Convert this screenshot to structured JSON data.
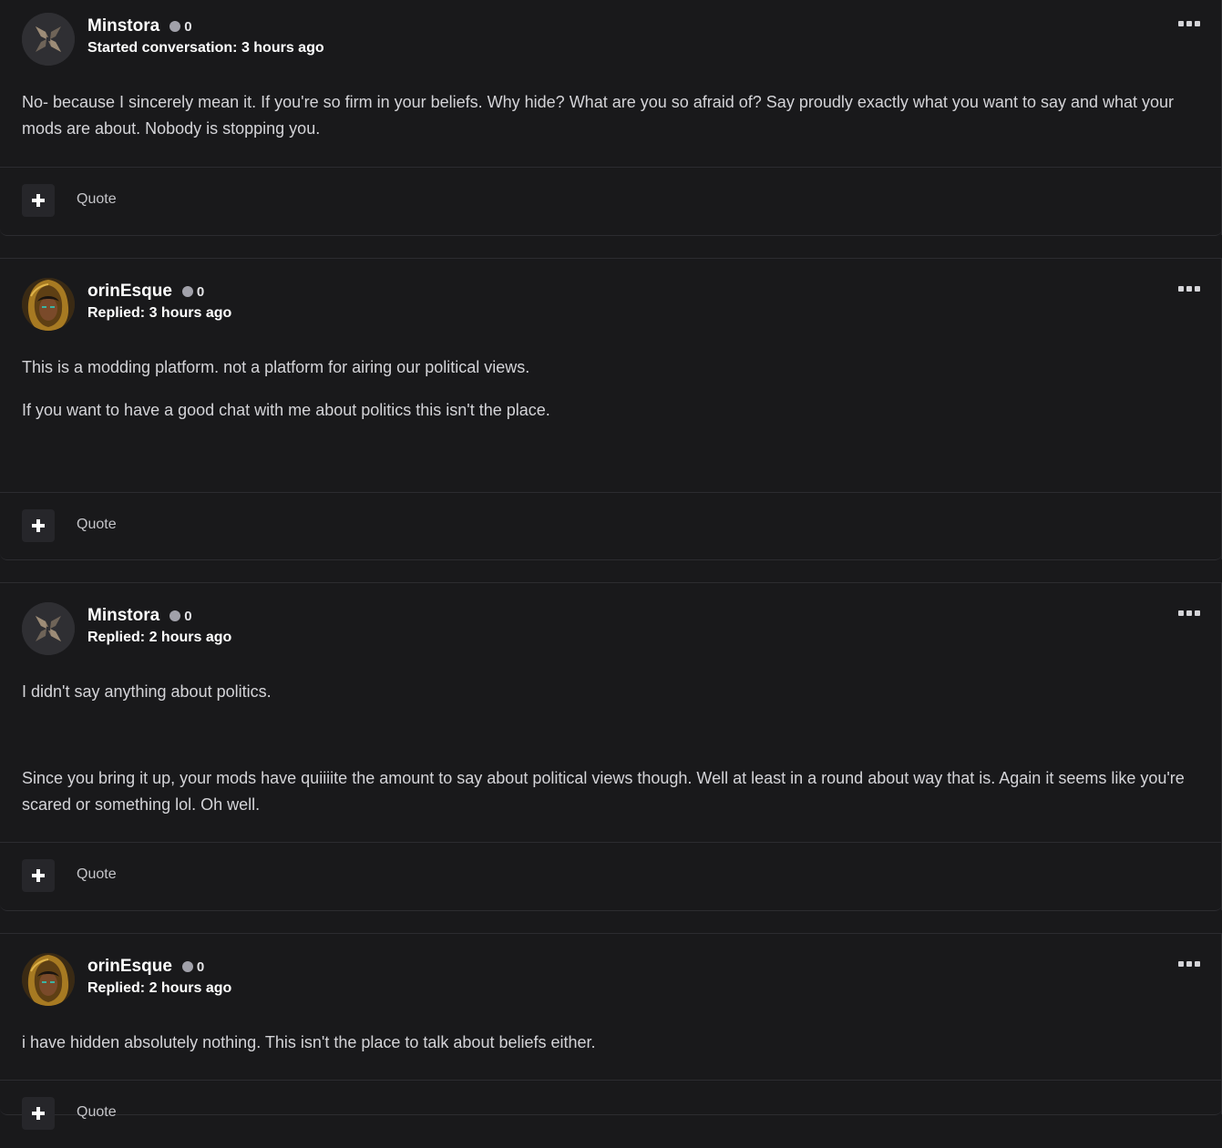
{
  "posts": [
    {
      "username": "Minstora",
      "reputation": "0",
      "action": "Started conversation:",
      "time": "3 hours ago",
      "avatar_icon": "default-avatar-icon",
      "paragraphs": [
        "No- because I sincerely mean it. If you're so firm in your beliefs. Why hide? What are you so afraid of? Say proudly exactly what you want to say and what your mods are about. Nobody is stopping you."
      ],
      "quote_label": "Quote"
    },
    {
      "username": "orinEsque",
      "reputation": "0",
      "action": "Replied:",
      "time": "3 hours ago",
      "avatar_icon": "hooded-character-avatar-icon",
      "paragraphs": [
        "This is a modding platform. not a platform for airing our political views.",
        "If you want to have a good chat with me about politics this isn't the place."
      ],
      "quote_label": "Quote"
    },
    {
      "username": "Minstora",
      "reputation": "0",
      "action": "Replied:",
      "time": "2 hours ago",
      "avatar_icon": "default-avatar-icon",
      "paragraphs": [
        "I didn't say anything about politics.",
        "Since you bring it up, your mods have quiiiite the amount to say about political views though. Well at least in a round about way that is. Again it seems like you're scared or something lol. Oh well."
      ],
      "quote_label": "Quote"
    },
    {
      "username": "orinEsque",
      "reputation": "0",
      "action": "Replied:",
      "time": "2 hours ago",
      "avatar_icon": "hooded-character-avatar-icon",
      "paragraphs": [
        "i have hidden absolutely nothing. This isn't the place to talk about beliefs either."
      ],
      "quote_label": "Quote"
    }
  ]
}
